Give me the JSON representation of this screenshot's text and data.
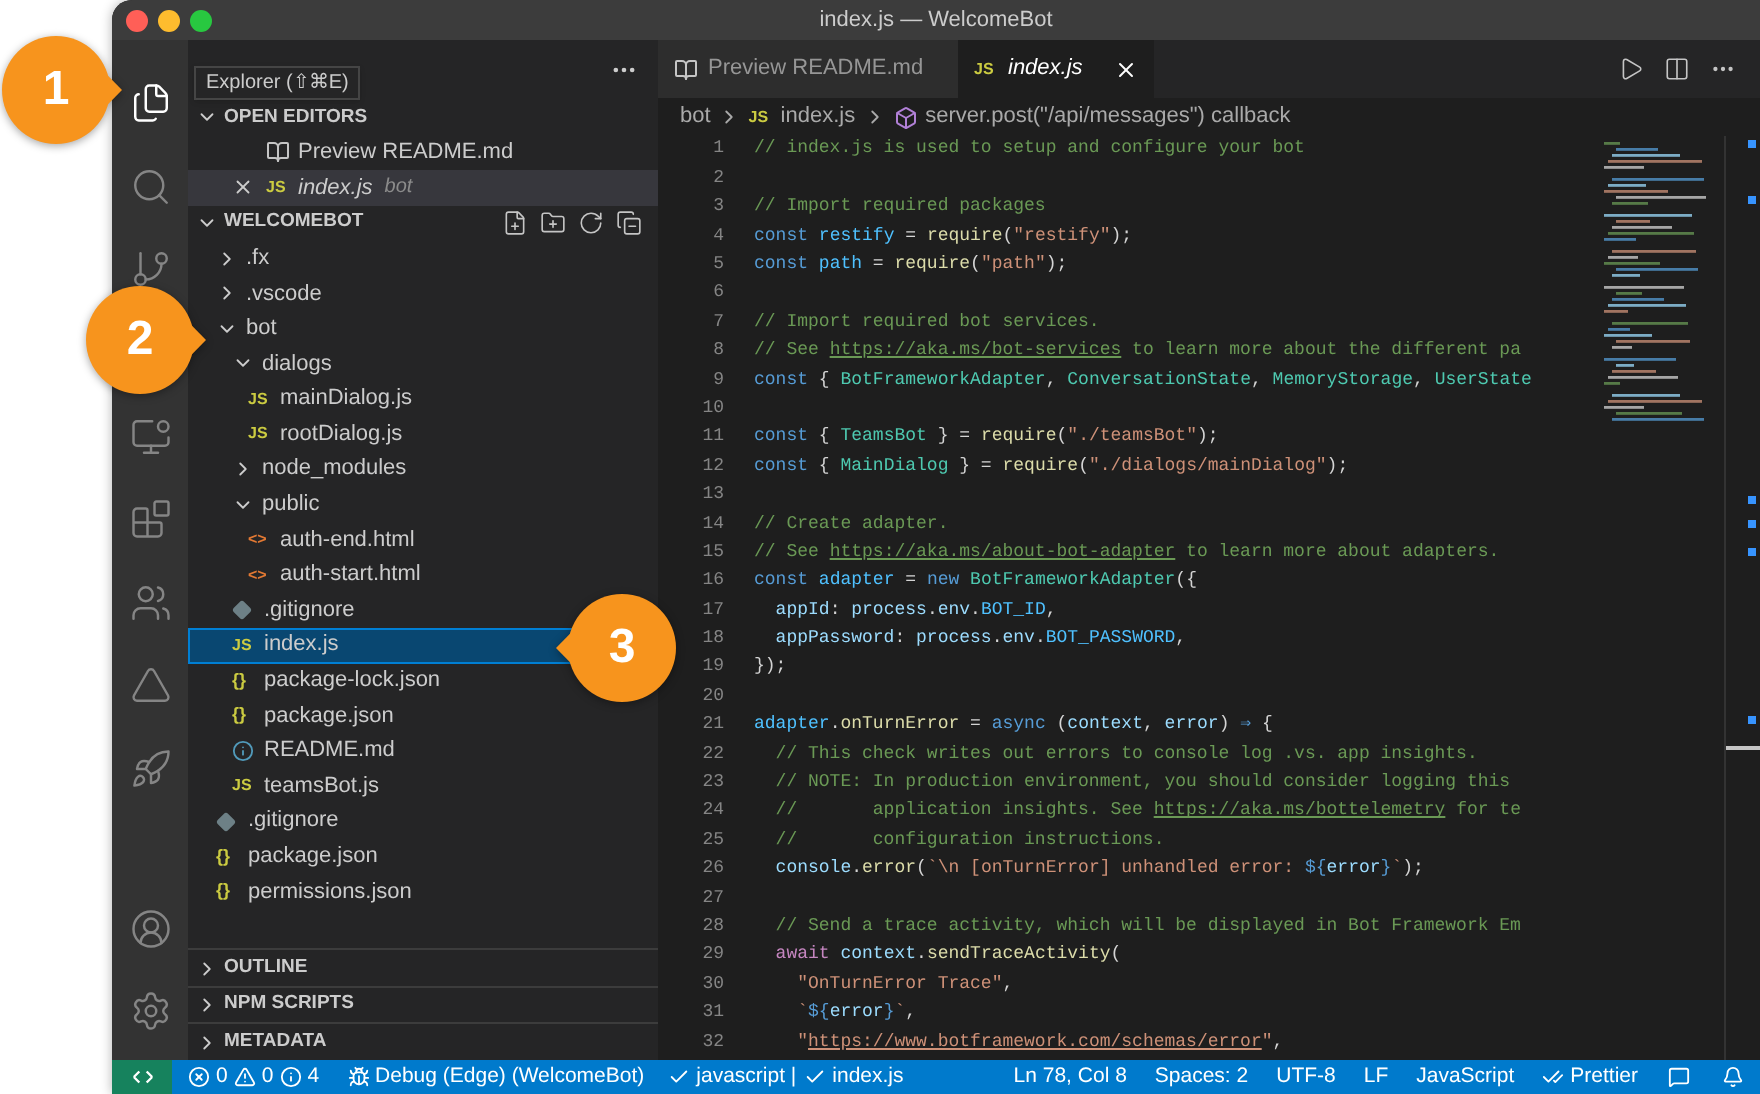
{
  "window": {
    "title": "index.js — WelcomeBot"
  },
  "activity_bar": {
    "top": [
      {
        "kind": "explorer",
        "selected": true
      },
      {
        "kind": "search",
        "selected": false
      },
      {
        "kind": "source_control",
        "selected": false
      },
      {
        "kind": "remote",
        "selected": false
      },
      {
        "kind": "extensions",
        "selected": false
      },
      {
        "kind": "teams",
        "selected": false
      },
      {
        "kind": "azure",
        "selected": false
      },
      {
        "kind": "deploy",
        "selected": false
      }
    ],
    "bottom": [
      {
        "kind": "account"
      },
      {
        "kind": "settings"
      }
    ]
  },
  "tooltip": "Explorer (⇧⌘E)",
  "open_editors": {
    "title": "OPEN EDITORS",
    "expanded": true,
    "items": [
      {
        "kind": "preview",
        "name": "Preview README.md",
        "preview": false,
        "selected": false
      },
      {
        "kind": "js",
        "icon": "JS",
        "name": "index.js",
        "description": "bot",
        "preview": true,
        "selected": true
      }
    ]
  },
  "folder": {
    "title": "WELCOMEBOT",
    "expanded": true,
    "tree": [
      {
        "kind": "folder",
        "name": ".fx",
        "expanded": false,
        "selected": false
      },
      {
        "kind": "folder",
        "name": ".vscode",
        "expanded": false,
        "selected": false
      },
      {
        "kind": "folder",
        "name": "bot",
        "expanded": true,
        "selected": false,
        "children": [
          {
            "kind": "folder",
            "name": "dialogs",
            "expanded": true,
            "selected": false,
            "children": [
              {
                "kind": "js",
                "icon": "JS",
                "name": "mainDialog.js",
                "selected": false
              },
              {
                "kind": "js",
                "icon": "JS",
                "name": "rootDialog.js",
                "selected": false
              }
            ]
          },
          {
            "kind": "folder",
            "name": "node_modules",
            "expanded": false,
            "selected": false
          },
          {
            "kind": "folder",
            "name": "public",
            "expanded": true,
            "selected": false,
            "children": [
              {
                "kind": "html",
                "icon": "<>",
                "name": "auth-end.html",
                "selected": false
              },
              {
                "kind": "html",
                "icon": "<>",
                "name": "auth-start.html",
                "selected": false
              }
            ]
          },
          {
            "kind": "git",
            "name": ".gitignore",
            "selected": false
          },
          {
            "kind": "js",
            "icon": "JS",
            "name": "index.js",
            "selected": true
          },
          {
            "kind": "json",
            "icon": "{}",
            "name": "package-lock.json",
            "selected": false
          },
          {
            "kind": "json",
            "icon": "{}",
            "name": "package.json",
            "selected": false
          },
          {
            "kind": "info",
            "name": "README.md",
            "selected": false
          },
          {
            "kind": "js",
            "icon": "JS",
            "name": "teamsBot.js",
            "selected": false
          }
        ]
      },
      {
        "kind": "git",
        "name": ".gitignore",
        "selected": false
      },
      {
        "kind": "json",
        "icon": "{}",
        "name": "package.json",
        "selected": false
      },
      {
        "kind": "json",
        "icon": "{}",
        "name": "permissions.json",
        "selected": false
      }
    ]
  },
  "collapsed_sections": [
    {
      "title": "OUTLINE",
      "expanded": false
    },
    {
      "title": "NPM SCRIPTS",
      "expanded": false
    },
    {
      "title": "METADATA",
      "expanded": false
    }
  ],
  "tabs": [
    {
      "kind": "preview",
      "label": "Preview README.md",
      "preview": false,
      "selected": false
    },
    {
      "kind": "js",
      "icon": "JS",
      "label": "index.js",
      "preview": true,
      "selected": true
    }
  ],
  "breadcrumb": [
    {
      "kind": "folder",
      "text": "bot"
    },
    {
      "kind": "js",
      "icon": "JS",
      "text": "index.js"
    },
    {
      "kind": "symbol",
      "text": "server.post(\"/api/messages\") callback"
    }
  ],
  "editor": {
    "lines": [
      {
        "number": "1",
        "tokens": [
          {
            "kind": "comment",
            "text": "// index.js is used to setup and configure your bot"
          }
        ]
      },
      {
        "number": "2"
      },
      {
        "number": "3",
        "tokens": [
          {
            "kind": "comment",
            "text": "// Import required packages"
          }
        ]
      },
      {
        "number": "4",
        "tokens": [
          {
            "kind": "keyword",
            "text": "const"
          },
          {
            "kind": "var",
            "text": " restify"
          },
          {
            "kind": "plain",
            "text": " = "
          },
          {
            "kind": "func",
            "text": "require"
          },
          {
            "kind": "plain",
            "text": "("
          },
          {
            "kind": "string",
            "text": "\"restify\""
          },
          {
            "kind": "plain",
            "text": ");"
          }
        ]
      },
      {
        "number": "5",
        "tokens": [
          {
            "kind": "keyword",
            "text": "const"
          },
          {
            "kind": "var",
            "text": " path"
          },
          {
            "kind": "plain",
            "text": " = "
          },
          {
            "kind": "func",
            "text": "require"
          },
          {
            "kind": "plain",
            "text": "("
          },
          {
            "kind": "string",
            "text": "\"path\""
          },
          {
            "kind": "plain",
            "text": ");"
          }
        ]
      },
      {
        "number": "6"
      },
      {
        "number": "7",
        "tokens": [
          {
            "kind": "comment",
            "text": "// Import required bot services."
          }
        ]
      },
      {
        "number": "8",
        "tokens": [
          {
            "kind": "comment",
            "text": "// See "
          },
          {
            "kind": "link",
            "text": "https://aka.ms/bot-services"
          },
          {
            "kind": "comment",
            "text": " to learn more about the different pa"
          }
        ]
      },
      {
        "number": "9",
        "tokens": [
          {
            "kind": "keyword",
            "text": "const"
          },
          {
            "kind": "plain",
            "text": " { "
          },
          {
            "kind": "type",
            "text": "BotFrameworkAdapter"
          },
          {
            "kind": "plain",
            "text": ", "
          },
          {
            "kind": "type",
            "text": "ConversationState"
          },
          {
            "kind": "plain",
            "text": ", "
          },
          {
            "kind": "type",
            "text": "MemoryStorage"
          },
          {
            "kind": "plain",
            "text": ", "
          },
          {
            "kind": "type",
            "text": "UserState"
          }
        ]
      },
      {
        "number": "10"
      },
      {
        "number": "11",
        "tokens": [
          {
            "kind": "keyword",
            "text": "const"
          },
          {
            "kind": "plain",
            "text": " { "
          },
          {
            "kind": "type",
            "text": "TeamsBot"
          },
          {
            "kind": "plain",
            "text": " } = "
          },
          {
            "kind": "func",
            "text": "require"
          },
          {
            "kind": "plain",
            "text": "("
          },
          {
            "kind": "string",
            "text": "\"./teamsBot\""
          },
          {
            "kind": "plain",
            "text": ");"
          }
        ]
      },
      {
        "number": "12",
        "tokens": [
          {
            "kind": "keyword",
            "text": "const"
          },
          {
            "kind": "plain",
            "text": " { "
          },
          {
            "kind": "type",
            "text": "MainDialog"
          },
          {
            "kind": "plain",
            "text": " } = "
          },
          {
            "kind": "func",
            "text": "require"
          },
          {
            "kind": "plain",
            "text": "("
          },
          {
            "kind": "string",
            "text": "\"./dialogs/mainDialog\""
          },
          {
            "kind": "plain",
            "text": ");"
          }
        ]
      },
      {
        "number": "13"
      },
      {
        "number": "14",
        "tokens": [
          {
            "kind": "comment",
            "text": "// Create adapter."
          }
        ]
      },
      {
        "number": "15",
        "tokens": [
          {
            "kind": "comment",
            "text": "// See "
          },
          {
            "kind": "link",
            "text": "https://aka.ms/about-bot-adapter"
          },
          {
            "kind": "comment",
            "text": " to learn more about adapters."
          }
        ]
      },
      {
        "number": "16",
        "tokens": [
          {
            "kind": "keyword",
            "text": "const"
          },
          {
            "kind": "var",
            "text": " adapter"
          },
          {
            "kind": "plain",
            "text": " = "
          },
          {
            "kind": "keyword",
            "text": "new"
          },
          {
            "kind": "type",
            "text": " BotFrameworkAdapter"
          },
          {
            "kind": "plain",
            "text": "({"
          }
        ]
      },
      {
        "number": "17",
        "tokens": [
          {
            "kind": "prop",
            "text": "  appId"
          },
          {
            "kind": "plain",
            "text": ": "
          },
          {
            "kind": "prop",
            "text": "process"
          },
          {
            "kind": "plain",
            "text": "."
          },
          {
            "kind": "prop",
            "text": "env"
          },
          {
            "kind": "plain",
            "text": "."
          },
          {
            "kind": "var",
            "text": "BOT_ID"
          },
          {
            "kind": "plain",
            "text": ","
          }
        ]
      },
      {
        "number": "18",
        "tokens": [
          {
            "kind": "prop",
            "text": "  appPassword"
          },
          {
            "kind": "plain",
            "text": ": "
          },
          {
            "kind": "prop",
            "text": "process"
          },
          {
            "kind": "plain",
            "text": "."
          },
          {
            "kind": "prop",
            "text": "env"
          },
          {
            "kind": "plain",
            "text": "."
          },
          {
            "kind": "var",
            "text": "BOT_PASSWORD"
          },
          {
            "kind": "plain",
            "text": ","
          }
        ]
      },
      {
        "number": "19",
        "tokens": [
          {
            "kind": "plain",
            "text": "});"
          }
        ]
      },
      {
        "number": "20"
      },
      {
        "number": "21",
        "tokens": [
          {
            "kind": "var",
            "text": "adapter"
          },
          {
            "kind": "plain",
            "text": "."
          },
          {
            "kind": "func",
            "text": "onTurnError"
          },
          {
            "kind": "plain",
            "text": " = "
          },
          {
            "kind": "keyword",
            "text": "async"
          },
          {
            "kind": "plain",
            "text": " ("
          },
          {
            "kind": "prop",
            "text": "context"
          },
          {
            "kind": "plain",
            "text": ", "
          },
          {
            "kind": "prop",
            "text": "error"
          },
          {
            "kind": "plain",
            "text": ") "
          },
          {
            "kind": "keyword",
            "text": "⇒"
          },
          {
            "kind": "plain",
            "text": " {"
          }
        ]
      },
      {
        "number": "22",
        "tokens": [
          {
            "kind": "comment",
            "text": "  // This check writes out errors to console log .vs. app insights."
          }
        ]
      },
      {
        "number": "23",
        "tokens": [
          {
            "kind": "comment",
            "text": "  // NOTE: In production environment, you should consider logging this"
          }
        ]
      },
      {
        "number": "24",
        "tokens": [
          {
            "kind": "comment",
            "text": "  //       application insights. See "
          },
          {
            "kind": "link",
            "text": "https://aka.ms/bottelemetry"
          },
          {
            "kind": "comment",
            "text": " for te"
          }
        ]
      },
      {
        "number": "25",
        "tokens": [
          {
            "kind": "comment",
            "text": "  //       configuration instructions."
          }
        ]
      },
      {
        "number": "26",
        "tokens": [
          {
            "kind": "prop",
            "text": "  console"
          },
          {
            "kind": "plain",
            "text": "."
          },
          {
            "kind": "func",
            "text": "error"
          },
          {
            "kind": "plain",
            "text": "("
          },
          {
            "kind": "string",
            "text": "`\\n [onTurnError] unhandled error: "
          },
          {
            "kind": "keyword",
            "text": "${"
          },
          {
            "kind": "prop",
            "text": "error"
          },
          {
            "kind": "keyword",
            "text": "}"
          },
          {
            "kind": "string",
            "text": "`"
          },
          {
            "kind": "plain",
            "text": ");"
          }
        ]
      },
      {
        "number": "27"
      },
      {
        "number": "28",
        "tokens": [
          {
            "kind": "comment",
            "text": "  // Send a trace activity, which will be displayed in Bot Framework Em"
          }
        ]
      },
      {
        "number": "29",
        "tokens": [
          {
            "kind": "control",
            "text": "  await"
          },
          {
            "kind": "prop",
            "text": " context"
          },
          {
            "kind": "plain",
            "text": "."
          },
          {
            "kind": "func",
            "text": "sendTraceActivity"
          },
          {
            "kind": "plain",
            "text": "("
          }
        ]
      },
      {
        "number": "30",
        "tokens": [
          {
            "kind": "string",
            "text": "    \"OnTurnError Trace\""
          },
          {
            "kind": "plain",
            "text": ","
          }
        ]
      },
      {
        "number": "31",
        "tokens": [
          {
            "kind": "string",
            "text": "    `"
          },
          {
            "kind": "keyword",
            "text": "${"
          },
          {
            "kind": "prop",
            "text": "error"
          },
          {
            "kind": "keyword",
            "text": "}"
          },
          {
            "kind": "string",
            "text": "`"
          },
          {
            "kind": "plain",
            "text": ","
          }
        ]
      },
      {
        "number": "32",
        "tokens": [
          {
            "kind": "string",
            "text": "    \""
          },
          {
            "kind": "string_link",
            "text": "https://www.botframework.com/schemas/error"
          },
          {
            "kind": "string",
            "text": "\""
          },
          {
            "kind": "plain",
            "text": ","
          }
        ]
      }
    ]
  },
  "status_bar": {
    "errors": "0",
    "warnings": "0",
    "infos": "4",
    "debug": "Debug (Edge) (WelcomeBot)",
    "left": [
      {
        "kind": "check",
        "text": "javascript |"
      },
      {
        "kind": "check",
        "text": "index.js"
      }
    ],
    "right": [
      {
        "kind": "plain",
        "text": "Ln 78, Col 8"
      },
      {
        "kind": "plain",
        "text": "Spaces: 2"
      },
      {
        "kind": "plain",
        "text": "UTF-8"
      },
      {
        "kind": "plain",
        "text": "LF"
      },
      {
        "kind": "plain",
        "text": "JavaScript"
      },
      {
        "kind": "double_check",
        "text": "Prettier"
      }
    ]
  },
  "callouts": [
    {
      "label": "1"
    },
    {
      "label": "2"
    },
    {
      "label": "3"
    }
  ]
}
